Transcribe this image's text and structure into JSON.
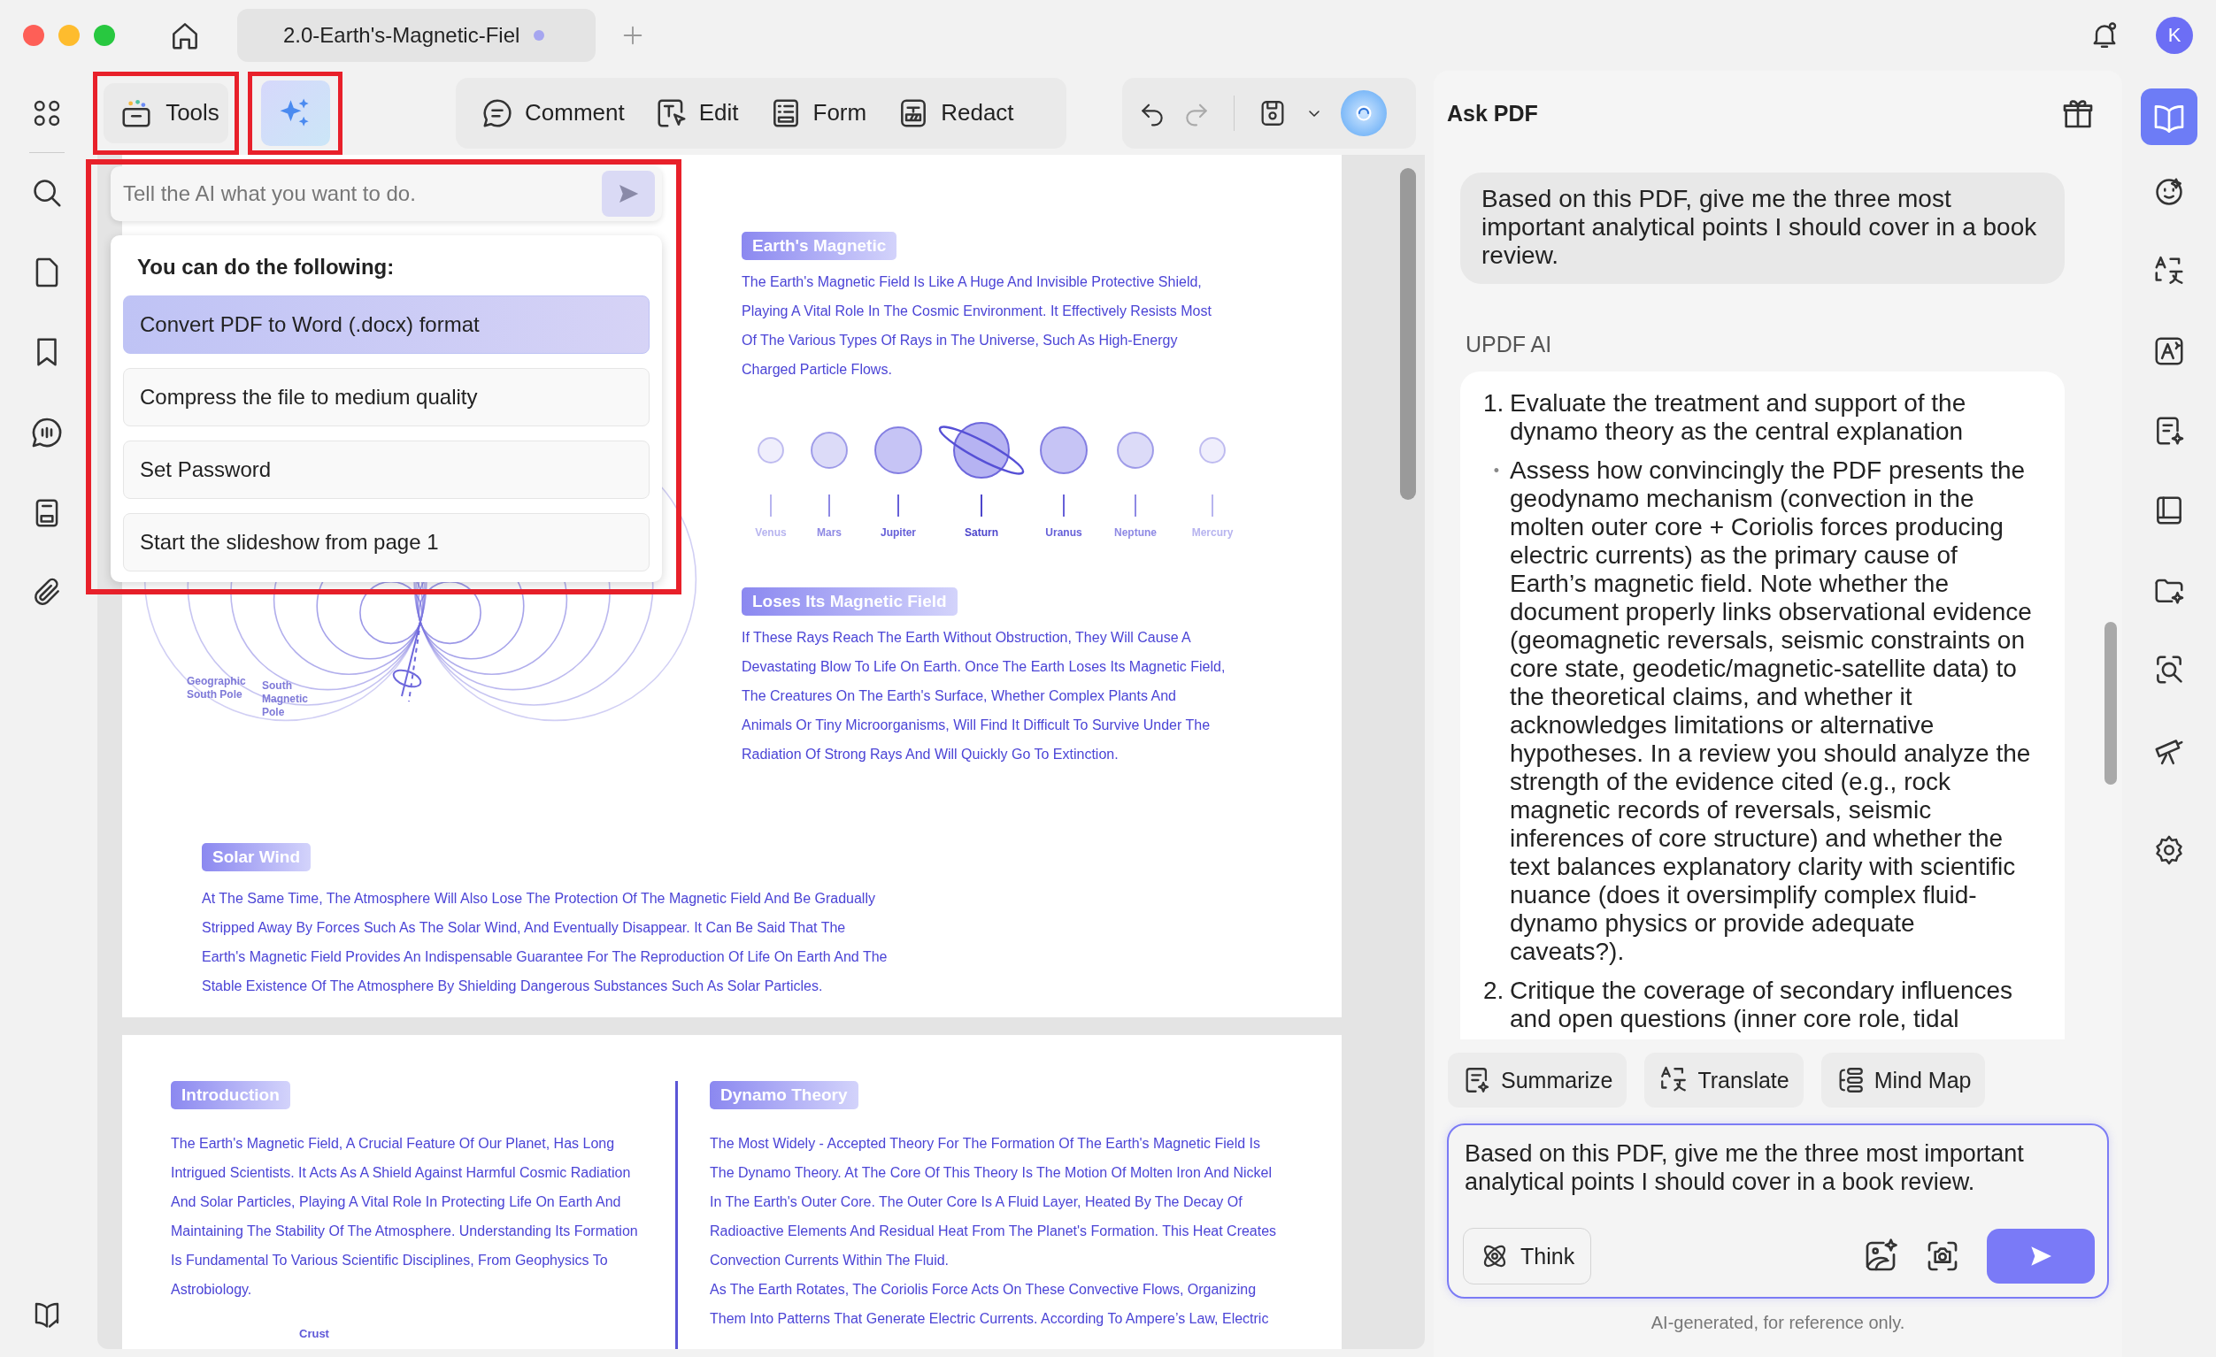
{
  "window": {
    "tab_title": "2.0-Earth's-Magnetic-Fiel",
    "avatar": "K"
  },
  "toolbar": {
    "tools": "Tools",
    "modes": [
      "Comment",
      "Edit",
      "Form",
      "Redact"
    ]
  },
  "ai_popup": {
    "placeholder": "Tell the AI what you want to do.",
    "heading": "You can do the following:",
    "options": [
      {
        "label": "Convert PDF to Word (.docx) format",
        "selected": true
      },
      {
        "label": "Compress the file to medium quality",
        "selected": false
      },
      {
        "label": "Set Password",
        "selected": false
      },
      {
        "label": "Start the slideshow from page 1",
        "selected": false
      }
    ]
  },
  "document": {
    "page1": {
      "field_labels": [
        "Geographic South Pole",
        "South Magnetic Pole"
      ],
      "sections": [
        {
          "heading": "Earth's Magnetic",
          "text": "The Earth's Magnetic Field Is Like A Huge And Invisible Protective Shield, Playing A Vital Role In The Cosmic Environment. It Effectively Resists Most Of The Various Types Of Rays in The Universe, Such As High-Energy Charged Particle Flows."
        },
        {
          "heading": "Loses Its Magnetic Field",
          "text": "If These Rays Reach The Earth Without Obstruction, They Will Cause A Devastating Blow To Life On Earth. Once The Earth Loses Its Magnetic Field, The Creatures On The Earth's Surface, Whether Complex Plants And Animals Or Tiny Microorganisms, Will Find It Difficult To Survive Under The Radiation Of Strong Rays And Will Quickly Go To Extinction."
        },
        {
          "heading": "Solar Wind",
          "text": "At The Same Time, The Atmosphere Will Also Lose The Protection Of The Magnetic Field And Be Gradually Stripped Away By Forces Such As The Solar Wind, And Eventually Disappear. It Can Be Said That The Earth's Magnetic Field Provides An Indispensable Guarantee For The Reproduction Of Life On Earth And The Stable Existence Of The Atmosphere By Shielding Dangerous Substances Such As Solar Particles."
        }
      ],
      "planets": [
        {
          "name": "Venus",
          "kind": "plain"
        },
        {
          "name": "Mars",
          "kind": "plain"
        },
        {
          "name": "Jupiter",
          "kind": "plain"
        },
        {
          "name": "Saturn",
          "kind": "ringed"
        },
        {
          "name": "Uranus",
          "kind": "plain"
        },
        {
          "name": "Neptune",
          "kind": "plain"
        },
        {
          "name": "Mercury",
          "kind": "plain"
        }
      ]
    },
    "page2": {
      "intro": {
        "heading": "Introduction",
        "text": "The Earth's Magnetic Field, A Crucial Feature Of Our Planet, Has Long Intrigued Scientists. It Acts As A Shield Against Harmful Cosmic Radiation And Solar Particles, Playing A Vital Role In Protecting Life On Earth And Maintaining The Stability Of The Atmosphere. Understanding Its Formation Is Fundamental To Various Scientific Disciplines, From Geophysics To Astrobiology.",
        "figure_label": "Crust"
      },
      "dynamo": {
        "heading": "Dynamo Theory",
        "paragraphs": [
          "The Most Widely - Accepted Theory For The Formation Of The Earth's Magnetic Field Is The Dynamo Theory. At The Core Of This Theory Is The Motion Of Molten Iron And Nickel In The Earth's Outer Core. The Outer Core Is A Fluid Layer, Heated By The Decay Of Radioactive Elements And Residual Heat From The Planet's Formation. This Heat Creates Convection Currents Within The Fluid.",
          "As The Earth Rotates, The Coriolis Force Acts On These Convective Flows, Organizing Them Into Patterns That Generate Electric Currents. According To Ampere’s Law, Electric"
        ]
      }
    }
  },
  "ask_pdf": {
    "title": "Ask PDF",
    "question": "Based on this PDF, give me the three most important analytical points I should cover in a book review.",
    "assistant": "UPDF AI",
    "answer": [
      {
        "kind": "numbered",
        "marker": "1.",
        "text": "Evaluate the treatment and support of the dynamo theory as the central explanation"
      },
      {
        "kind": "bullet",
        "marker": "•",
        "text": "Assess how convincingly the PDF presents the geodynamo mechanism (convection in the molten outer core + Coriolis forces producing electric currents) as the primary cause of Earth’s magnetic field. Note whether the document properly links observational evidence (geomagnetic reversals, seismic constraints on core state, geodetic/magnetic-satellite data) to the theoretical claims, and whether it acknowledges limitations or alternative hypotheses. In a review you should analyze the strength of the evidence cited (e.g., rock magnetic records of reversals, seismic inferences of core structure) and whether the text balances explanatory clarity with scientific nuance (does it oversimplify complex fluid-dynamo physics or provide adequate caveats?)."
      },
      {
        "kind": "numbered",
        "marker": "2.",
        "text": "Critique the coverage of secondary influences and open questions (inner core role, tidal"
      }
    ],
    "actions": [
      "Summarize",
      "Translate",
      "Mind Map"
    ],
    "input_value": "Based on this PDF, give me the three most important analytical points I should cover in a book review.",
    "think": "Think",
    "footer": "AI-generated, for reference only."
  }
}
